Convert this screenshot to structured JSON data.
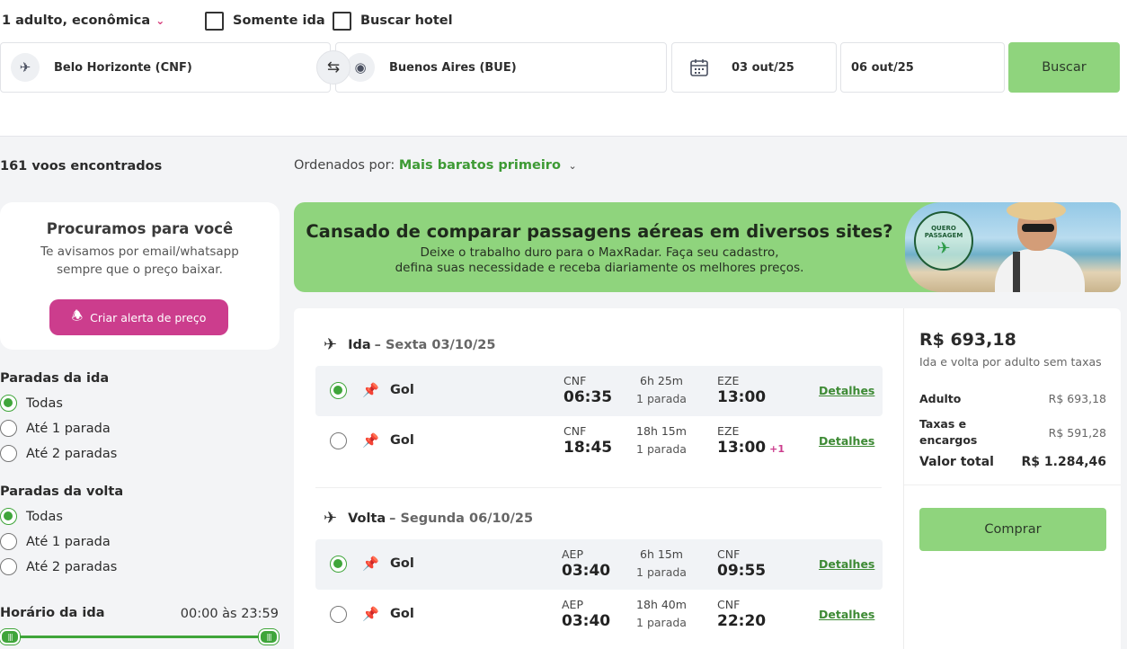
{
  "search": {
    "passengers": "1 adulto, econômica",
    "one_way_label": "Somente ida",
    "hotel_label": "Buscar hotel",
    "origin": "Belo Horizonte (CNF)",
    "destination": "Buenos Aires (BUE)",
    "depart_date": "03 out/25",
    "return_date": "06 out/25",
    "search_button": "Buscar"
  },
  "results": {
    "count_text": "161 voos encontrados",
    "sort_label": "Ordenados por:",
    "sort_value": "Mais baratos primeiro"
  },
  "alert_card": {
    "title": "Procuramos para você",
    "line1": "Te avisamos por email/whatsapp",
    "line2": "sempre que o preço baixar.",
    "button": "Criar alerta de preço"
  },
  "filters": {
    "outbound_title": "Paradas da ida",
    "return_title": "Paradas da volta",
    "options": [
      "Todas",
      "Até 1 parada",
      "Até 2 paradas"
    ],
    "outbound_selected": 0,
    "return_selected": 0,
    "time_title": "Horário da ida",
    "time_range": "00:00 às 23:59"
  },
  "banner": {
    "title": "Cansado de comparar passagens aéreas em diversos sites?",
    "line1": "Deixe o trabalho duro para o MaxRadar. Faça seu cadastro,",
    "line2": "defina suas necessidade e receba diariamente os melhores preços.",
    "stamp_text": "QUERO PASSAGEM"
  },
  "outbound": {
    "label": "Ida",
    "date": "– Sexta 03/10/25",
    "flights": [
      {
        "airline": "Gol",
        "from": "CNF",
        "dep": "06:35",
        "duration": "6h 25m",
        "stops": "1 parada",
        "to": "EZE",
        "arr": "13:00",
        "plus": "",
        "details": "Detalhes",
        "selected": true
      },
      {
        "airline": "Gol",
        "from": "CNF",
        "dep": "18:45",
        "duration": "18h 15m",
        "stops": "1 parada",
        "to": "EZE",
        "arr": "13:00",
        "plus": "+1",
        "details": "Detalhes",
        "selected": false
      }
    ]
  },
  "inbound": {
    "label": "Volta",
    "date": "– Segunda 06/10/25",
    "flights": [
      {
        "airline": "Gol",
        "from": "AEP",
        "dep": "03:40",
        "duration": "6h 15m",
        "stops": "1 parada",
        "to": "CNF",
        "arr": "09:55",
        "plus": "",
        "details": "Detalhes",
        "selected": true
      },
      {
        "airline": "Gol",
        "from": "AEP",
        "dep": "03:40",
        "duration": "18h 40m",
        "stops": "1 parada",
        "to": "CNF",
        "arr": "22:20",
        "plus": "",
        "details": "Detalhes",
        "selected": false
      }
    ]
  },
  "price_panel": {
    "price": "R$ 693,18",
    "subtitle": "Ida e volta por adulto sem taxas",
    "adult_label": "Adulto",
    "adult_value": "R$ 693,18",
    "taxes_label_1": "Taxas e",
    "taxes_label_2": "encargos",
    "taxes_value": "R$ 591,28",
    "total_label": "Valor total",
    "total_value": "R$ 1.284,46",
    "buy_button": "Comprar"
  },
  "colors": {
    "accent_green": "#8fd47d",
    "selected_green": "#3fa53a",
    "alert_pink": "#cc3d8d"
  }
}
